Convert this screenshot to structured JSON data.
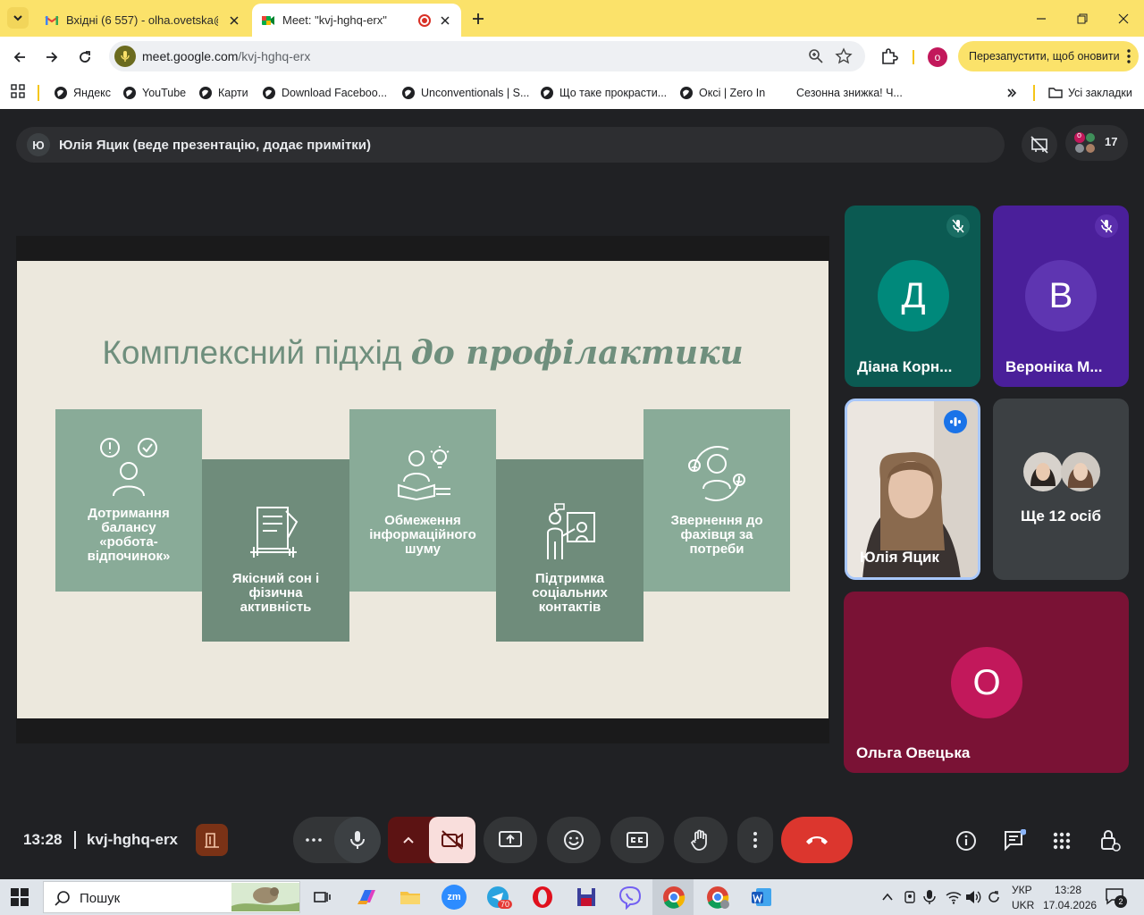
{
  "browser": {
    "tabs": [
      {
        "title": "Вхідні (6 557) - olha.ovetska@n",
        "favicon": "gmail-icon",
        "active": false
      },
      {
        "title": "Meet: \"kvj-hghq-erx\"",
        "favicon": "meet-icon",
        "active": true,
        "recording": true
      }
    ],
    "url_host": "meet.google.com",
    "url_path": "/kvj-hghq-erx",
    "profile_initial": "о",
    "update_button": "Перезапустити, щоб оновити",
    "bookmarks": [
      "Яндекс",
      "YouTube",
      "Карти",
      "Download Faceboo...",
      "Unconventionals | S...",
      "Що таке прокрасти...",
      "Оксі | Zero In",
      "Сезонна знижка! Ч..."
    ],
    "all_bookmarks": "Усі закладки"
  },
  "meet": {
    "presenter": {
      "initial": "Ю",
      "text": "Юлія Яцик (веде презентацію, додає примітки)"
    },
    "people_count": "17",
    "people_badge_initial": "о",
    "slide": {
      "title_regular": "Комплексний підхід",
      "title_bold": "до профілактики",
      "cards": [
        {
          "label": "Дотримання балансу «робота-відпочинок»",
          "icon": "person-thinking-icon"
        },
        {
          "label": "Якісний сон і фізична активність",
          "icon": "checklist-dumbbell-icon"
        },
        {
          "label": "Обмеження інформаційного шуму",
          "icon": "reader-lightbulb-icon"
        },
        {
          "label": "Підтримка соціальних контактів",
          "icon": "people-talking-icon"
        },
        {
          "label": "Звернення до фахівця за потреби",
          "icon": "mental-health-icon"
        }
      ]
    },
    "participants": [
      {
        "name": "Діана Корн...",
        "initial": "Д",
        "color": "#00796b",
        "bg": "#0b5a52",
        "muted": true
      },
      {
        "name": "Вероніка М...",
        "initial": "В",
        "color": "#5e35b1",
        "bg": "#4a1f9a",
        "muted": true
      },
      {
        "name": "Юлія Яцик",
        "speaking": true
      },
      {
        "name": "Ще 12 осіб"
      },
      {
        "name": "Ольга Овецька",
        "initial": "О",
        "color": "#c2185b",
        "bg": "#7a1235"
      }
    ],
    "time": "13:28",
    "meeting_code": "kvj-hghq-erx"
  },
  "taskbar": {
    "search_placeholder": "Пошук",
    "telegram_badge": "70",
    "lang_top": "УКР",
    "lang_bottom": "UKR",
    "time": "13:28",
    "date": "17.04.2026",
    "notifications": "2"
  }
}
